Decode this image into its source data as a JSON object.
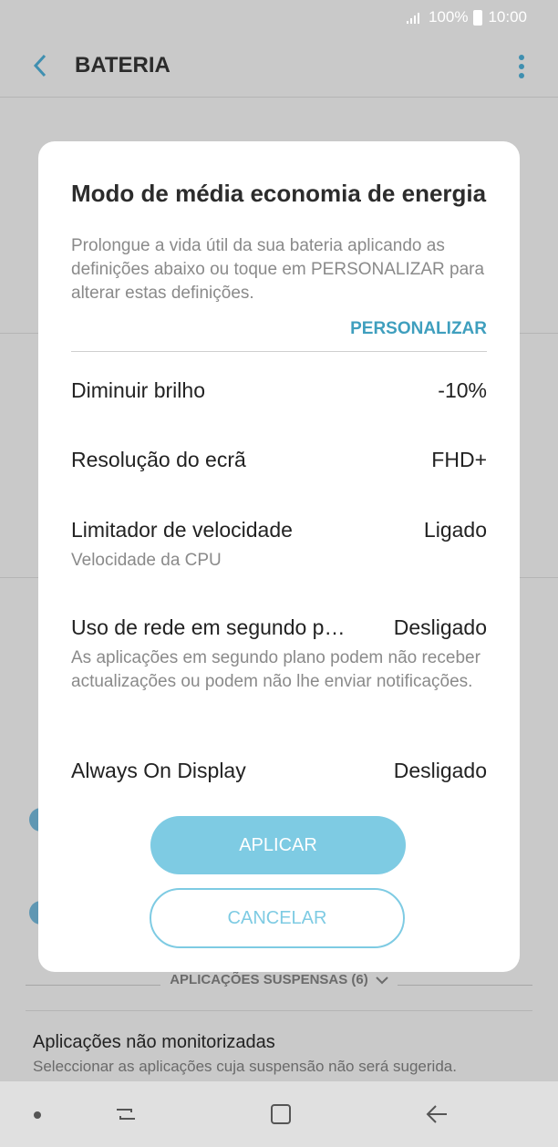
{
  "status_bar": {
    "battery_text": "100%",
    "time": "10:00",
    "icons": [
      "signal-icon",
      "battery-icon"
    ]
  },
  "app_bar": {
    "title": "BATERIA",
    "back_icon": "chevron-left-icon",
    "more_icon": "more-vertical-icon"
  },
  "background": {
    "suspended_label": "APLICAÇÕES SUSPENSAS (6)",
    "unmonitored_title": "Aplicações não monitorizadas",
    "unmonitored_sub": "Seleccionar as aplicações cuja suspensão não será sugerida."
  },
  "dialog": {
    "title": "Modo de média economia de energia",
    "description": "Prolongue a vida útil da sua bateria aplicando as definições abaixo ou toque em PERSONALIZAR para alterar estas definições.",
    "customize_label": "PERSONALIZAR",
    "rows": [
      {
        "label": "Diminuir brilho",
        "value": "-10%",
        "sub": ""
      },
      {
        "label": "Resolução do ecrã",
        "value": "FHD+",
        "sub": ""
      },
      {
        "label": "Limitador de velocidade",
        "value": "Ligado",
        "sub": "Velocidade da CPU"
      },
      {
        "label": "Uso de rede em segundo p…",
        "value": "Desligado",
        "sub": "As aplicações em segundo plano podem não receber actualizações ou podem não lhe enviar notificações."
      },
      {
        "label": "Always On Display",
        "value": "Desligado",
        "sub": ""
      }
    ],
    "apply_label": "APLICAR",
    "cancel_label": "CANCELAR"
  },
  "navigation_bar": {
    "icons": [
      "dot-icon",
      "recents-icon",
      "home-icon",
      "back-icon"
    ]
  },
  "colors": {
    "accent": "#3f9fbe",
    "button": "#7ecbe3",
    "scrim": "#c9c9c9"
  }
}
